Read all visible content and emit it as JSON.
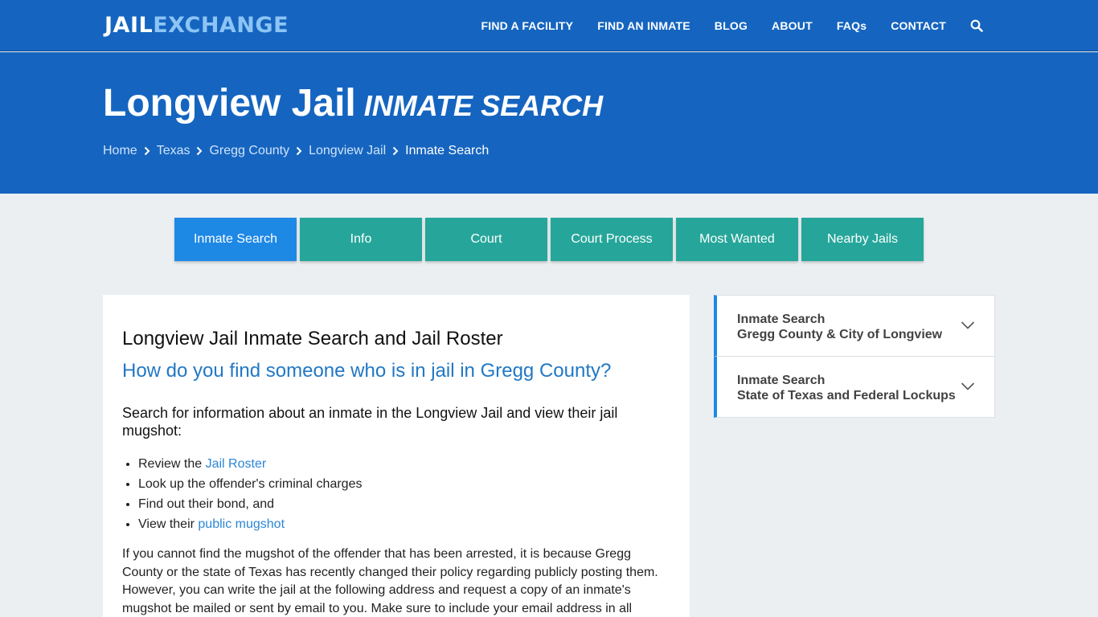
{
  "header": {
    "logo_part1": "JAIL",
    "logo_part2": "EXCHANGE",
    "nav": [
      "FIND A FACILITY",
      "FIND AN INMATE",
      "BLOG",
      "ABOUT",
      "FAQs",
      "CONTACT"
    ],
    "search_icon": "search-icon"
  },
  "hero": {
    "title": "Longview Jail",
    "subtitle": "INMATE SEARCH",
    "breadcrumbs": [
      "Home",
      "Texas",
      "Gregg County",
      "Longview Jail",
      "Inmate Search"
    ]
  },
  "tabs": [
    "Inmate Search",
    "Info",
    "Court",
    "Court Process",
    "Most Wanted",
    "Nearby Jails"
  ],
  "main": {
    "heading": "Longview Jail Inmate Search and Jail Roster",
    "question": "How do you find someone who is in jail in Gregg County?",
    "intro": "Search for information about an inmate in the Longview Jail and view their jail mugshot:",
    "list": [
      {
        "before": "Review the ",
        "link": "Jail Roster"
      },
      {
        "before": "Look up the offender's criminal charges",
        "link": ""
      },
      {
        "before": "Find out their bond, and",
        "link": ""
      },
      {
        "before": "View their ",
        "link": "public mugshot"
      }
    ],
    "paragraph": "If you cannot find the mugshot of the offender that has been arrested, it is because Gregg County or the state of Texas has recently changed their policy regarding publicly posting them. However, you can write the jail at the following address and request a copy of an inmate's mugshot be mailed or sent by email to you. Make sure to include your email address in all"
  },
  "sidebar": {
    "items": [
      {
        "line1": "Inmate Search",
        "line2": "Gregg County & City of Longview"
      },
      {
        "line1": "Inmate Search",
        "line2": "State of Texas and Federal Lockups"
      }
    ]
  },
  "colors": {
    "brand_blue": "#1565c0",
    "tab_teal": "#26a69a",
    "tab_active": "#1e88e5",
    "link_blue": "#2b86d6"
  }
}
